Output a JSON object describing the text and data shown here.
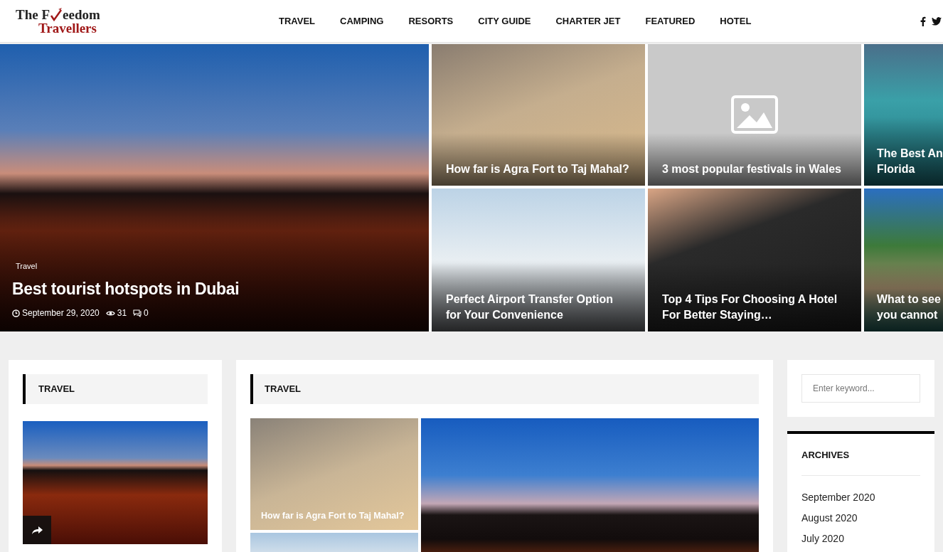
{
  "logo": {
    "line_1a": "The F",
    "line_1b": "eedom",
    "line_2": "Travellers"
  },
  "nav": [
    {
      "label": "TRAVEL"
    },
    {
      "label": "CAMPING"
    },
    {
      "label": "RESORTS"
    },
    {
      "label": "CITY GUIDE"
    },
    {
      "label": "CHARTER JET"
    },
    {
      "label": "FEATURED"
    },
    {
      "label": "HOTEL"
    }
  ],
  "featured": {
    "category": "Travel",
    "title": "Best tourist hotspots in Dubai",
    "date": "September 29, 2020",
    "views": "31",
    "comments": "0"
  },
  "tiles": [
    {
      "title": "How far is Agra Fort to Taj Mahal?",
      "kind": "photo"
    },
    {
      "title": "3 most popular festivals in Wales",
      "kind": "no-image"
    },
    {
      "title": "The Best An\nFlorida",
      "kind": "photo"
    },
    {
      "title": "Perfect Airport Transfer Option for Your Convenience",
      "kind": "photo"
    },
    {
      "title": "Top 4 Tips For Choosing A Hotel For Better Staying…",
      "kind": "photo"
    },
    {
      "title": "What to see\nyou cannot",
      "kind": "photo"
    }
  ],
  "left_widget": {
    "heading": "TRAVEL"
  },
  "middle_widget": {
    "heading": "TRAVEL",
    "posts": [
      {
        "title": "How far is Agra Fort to Taj Mahal?"
      }
    ]
  },
  "search": {
    "placeholder": "Enter keyword..."
  },
  "archives": {
    "heading": "ARCHIVES",
    "items": [
      {
        "label": "September 2020"
      },
      {
        "label": "August 2020"
      },
      {
        "label": "July 2020"
      }
    ]
  }
}
